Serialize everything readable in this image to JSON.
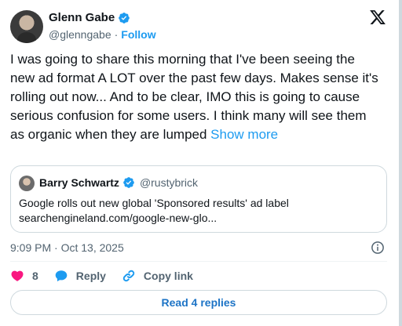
{
  "author": {
    "name": "Glenn Gabe",
    "handle": "@glenngabe",
    "separator": "·",
    "follow_label": "Follow"
  },
  "tweet": {
    "text": "I was going to share this morning that I've been seeing the new ad format A LOT over the past few days. Makes sense it's rolling out now... And to be clear, IMO this is going to cause serious confusion for some users. I think many will see them as organic when they are lumped ",
    "show_more_label": "Show more"
  },
  "quoted": {
    "name": "Barry Schwartz",
    "handle": "@rustybrick",
    "text_line1": "Google rolls out new global 'Sponsored results' ad label",
    "text_line2": "searchengineland.com/google-new-glo..."
  },
  "timestamp": "9:09 PM · Oct 13, 2025",
  "actions": {
    "like_count": "8",
    "reply_label": "Reply",
    "copy_link_label": "Copy link"
  },
  "read_replies_label": "Read 4 replies",
  "colors": {
    "accent": "#1d9bf0",
    "like": "#f91880",
    "text": "#0f1419",
    "muted": "#536471",
    "border": "#cfd9de"
  },
  "icons": [
    "verified-badge-icon",
    "x-logo-icon",
    "info-icon",
    "heart-icon",
    "reply-bubble-icon",
    "link-icon"
  ]
}
